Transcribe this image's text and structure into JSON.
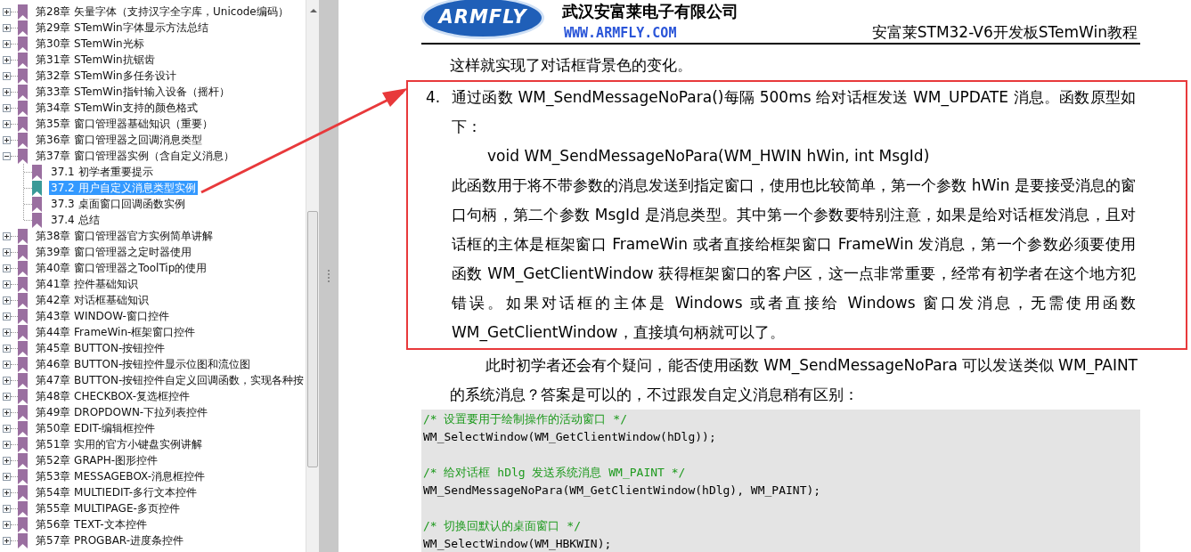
{
  "bookmarks": [
    {
      "label": "第28章 矢量字体（支持汉字全字库，Unicode编码）",
      "expanded": false,
      "selected": false
    },
    {
      "label": "第29章 STemWin字体显示方法总结",
      "expanded": false,
      "selected": false
    },
    {
      "label": "第30章 STemWin光标",
      "expanded": false,
      "selected": false
    },
    {
      "label": "第31章 STemWin抗锯齿",
      "expanded": false,
      "selected": false
    },
    {
      "label": "第32章 STemWin多任务设计",
      "expanded": false,
      "selected": false
    },
    {
      "label": "第33章 STemWin指针输入设备（摇杆）",
      "expanded": false,
      "selected": false
    },
    {
      "label": "第34章 STemWin支持的颜色格式",
      "expanded": false,
      "selected": false
    },
    {
      "label": "第35章 窗口管理器基础知识（重要）",
      "expanded": false,
      "selected": false
    },
    {
      "label": "第36章 窗口管理器之回调消息类型",
      "expanded": false,
      "selected": false
    },
    {
      "label": "第37章 窗口管理器实例（含自定义消息）",
      "expanded": true,
      "selected": false,
      "children": [
        {
          "label": "37.1 初学者重要提示",
          "selected": false
        },
        {
          "label": "37.2 用户自定义消息类型实例",
          "selected": true
        },
        {
          "label": "37.3 桌面窗口回调函数实例",
          "selected": false
        },
        {
          "label": "37.4 总结",
          "selected": false
        }
      ]
    },
    {
      "label": "第38章 窗口管理器官方实例简单讲解",
      "expanded": false,
      "selected": false
    },
    {
      "label": "第39章 窗口管理器之定时器使用",
      "expanded": false,
      "selected": false
    },
    {
      "label": "第40章 窗口管理器之ToolTip的使用",
      "expanded": false,
      "selected": false
    },
    {
      "label": "第41章 控件基础知识",
      "expanded": false,
      "selected": false
    },
    {
      "label": "第42章 对话框基础知识",
      "expanded": false,
      "selected": false
    },
    {
      "label": "第43章 WINDOW-窗口控件",
      "expanded": false,
      "selected": false
    },
    {
      "label": "第44章 FrameWin-框架窗口控件",
      "expanded": false,
      "selected": false
    },
    {
      "label": "第45章 BUTTON-按钮控件",
      "expanded": false,
      "selected": false
    },
    {
      "label": "第46章 BUTTON-按钮控件显示位图和流位图",
      "expanded": false,
      "selected": false
    },
    {
      "label": "第47章 BUTTON-按钮控件自定义回调函数，实现各种按",
      "expanded": false,
      "selected": false
    },
    {
      "label": "第48章 CHECKBOX-复选框控件",
      "expanded": false,
      "selected": false
    },
    {
      "label": "第49章 DROPDOWN-下拉列表控件",
      "expanded": false,
      "selected": false
    },
    {
      "label": "第50章 EDIT-编辑框控件",
      "expanded": false,
      "selected": false
    },
    {
      "label": "第51章 实用的官方小键盘实例讲解",
      "expanded": false,
      "selected": false
    },
    {
      "label": "第52章 GRAPH-图形控件",
      "expanded": false,
      "selected": false
    },
    {
      "label": "第53章 MESSAGEBOX-消息框控件",
      "expanded": false,
      "selected": false
    },
    {
      "label": "第54章 MULTIEDIT-多行文本控件",
      "expanded": false,
      "selected": false
    },
    {
      "label": "第55章 MULTIPAGE-多页控件",
      "expanded": false,
      "selected": false
    },
    {
      "label": "第56章 TEXT-文本控件",
      "expanded": false,
      "selected": false
    },
    {
      "label": "第57章 PROGBAR-进度条控件",
      "expanded": false,
      "selected": false
    }
  ],
  "page": {
    "header": {
      "logo": "ARMFLY",
      "company": "武汉安富莱电子有限公司",
      "website": "WWW.ARMFLY.COM",
      "doc_title": "安富莱STM32-V6开发板STemWin教程"
    },
    "intro": "这样就实现了对话框背景色的变化。",
    "list_item": {
      "number": "4.",
      "text": "通过函数 WM_SendMessageNoPara()每隔 500ms 给对话框发送 WM_UPDATE 消息。函数原型如下：",
      "prototype": "void WM_SendMessageNoPara(WM_HWIN hWin, int MsgId)",
      "description": "此函数用于将不带参数的消息发送到指定窗口，使用也比较简单，第一个参数 hWin 是要接受消息的窗口句柄，第二个参数 MsgId 是消息类型。其中第一个参数要特别注意，如果是给对话框发消息，且对话框的主体是框架窗口 FrameWin 或者直接给框架窗口 FrameWin 发消息，第一个参数必须要使用函数 WM_GetClientWindow 获得框架窗口的客户区，这一点非常重要，经常有初学者在这个地方犯错误。如果对话框的主体是 Windows 或者直接给 Windows 窗口发消息，无需使用函数 WM_GetClientWindow，直接填句柄就可以了。"
    },
    "after": "此时初学者还会有个疑问，能否使用函数 WM_SendMessageNoPara 可以发送类似 WM_PAINT 的系统消息？答案是可以的，不过跟发自定义消息稍有区别：",
    "code": [
      {
        "comment": "/* 设置要用于绘制操作的活动窗口 */",
        "code": "WM_SelectWindow(WM_GetClientWindow(hDlg));"
      },
      {
        "comment": "/* 给对话框 hDlg 发送系统消息 WM_PAINT */",
        "code": "WM_SendMessageNoPara(WM_GetClientWindow(hDlg), WM_PAINT);"
      },
      {
        "comment": "/* 切换回默认的桌面窗口 */",
        "code": "WM_SelectWindow(WM_HBKWIN);"
      }
    ]
  }
}
